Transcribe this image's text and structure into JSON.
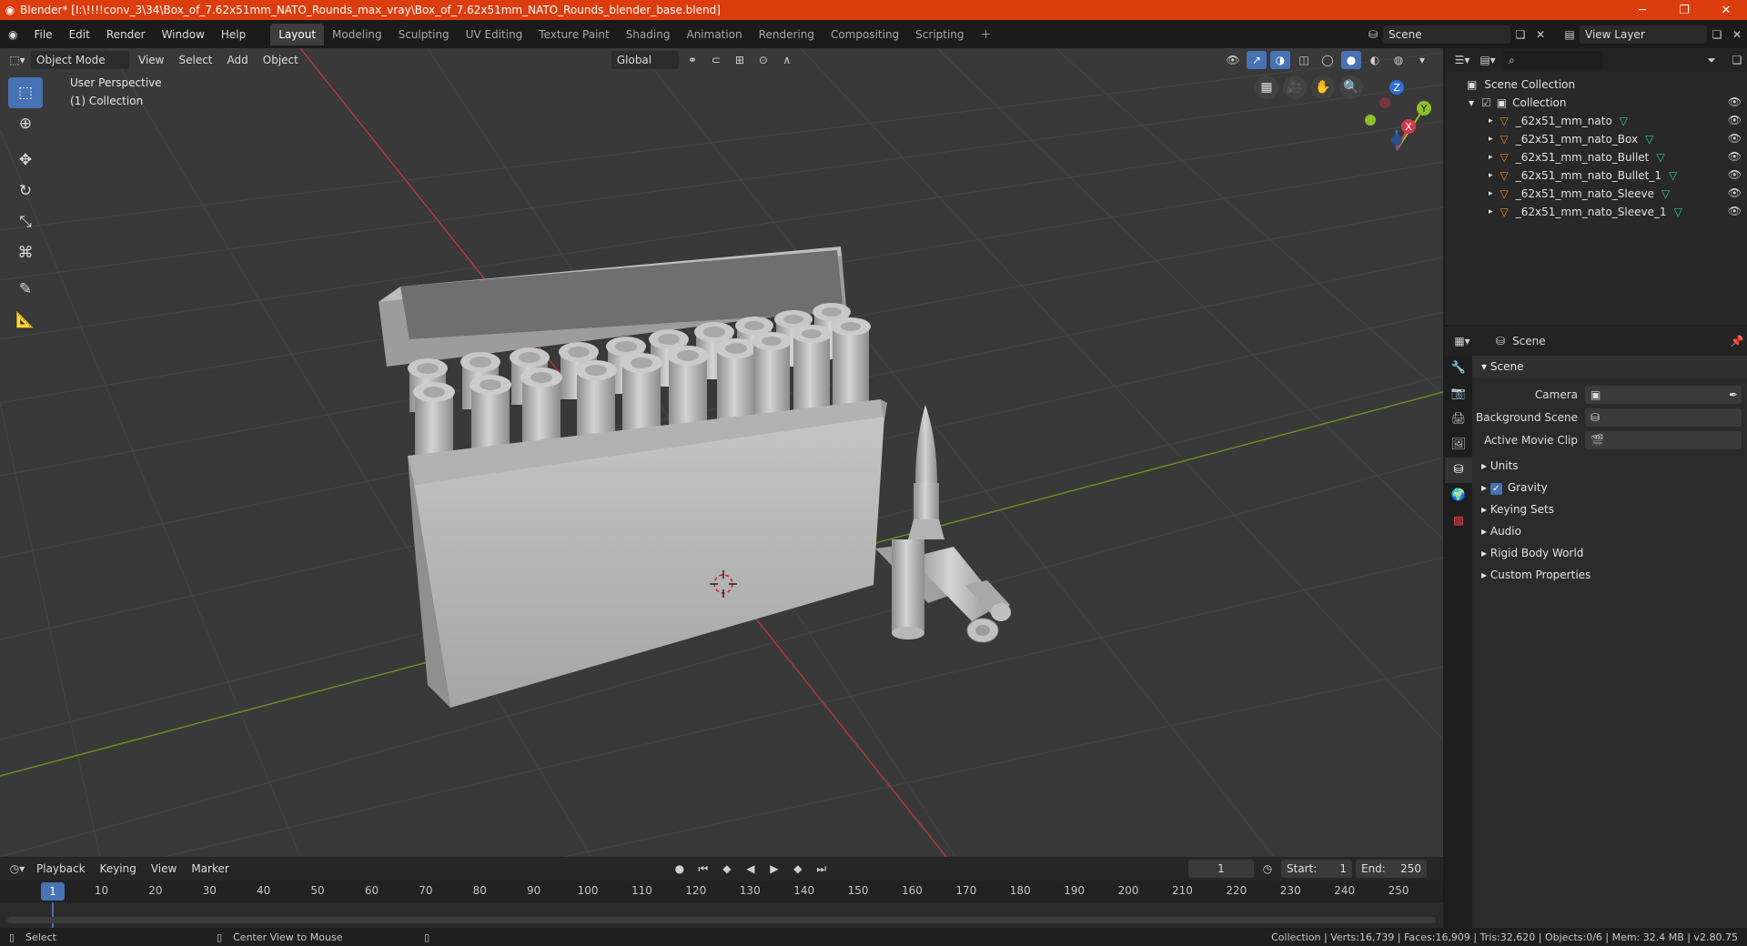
{
  "titlebar": {
    "text": "Blender* [I:\\!!!!conv_3\\34\\Box_of_7.62x51mm_NATO_Rounds_max_vray\\Box_of_7.62x51mm_NATO_Rounds_blender_base.blend]",
    "accent": "#dc3d0e"
  },
  "menu": [
    "File",
    "Edit",
    "Render",
    "Window",
    "Help"
  ],
  "workspaces": [
    "Layout",
    "Modeling",
    "Sculpting",
    "UV Editing",
    "Texture Paint",
    "Shading",
    "Animation",
    "Rendering",
    "Compositing",
    "Scripting"
  ],
  "active_workspace": "Layout",
  "scene_field": "Scene",
  "view_layer_field": "View Layer",
  "viewport": {
    "mode": "Object Mode",
    "menus": [
      "View",
      "Select",
      "Add",
      "Object"
    ],
    "transform": "Global",
    "info_line1": "User Perspective",
    "info_line2": "(1) Collection",
    "gizmo": {
      "x": "X",
      "y": "Y",
      "z": "Z"
    }
  },
  "outliner": {
    "root": "Scene Collection",
    "collection": "Collection",
    "objects": [
      "_62x51_mm_nato",
      "_62x51_mm_nato_Box",
      "_62x51_mm_nato_Bullet",
      "_62x51_mm_nato_Bullet_1",
      "_62x51_mm_nato_Sleeve",
      "_62x51_mm_nato_Sleeve_1"
    ]
  },
  "properties": {
    "header": "Scene",
    "section": "Scene",
    "camera_label": "Camera",
    "background_scene_label": "Background Scene",
    "movie_clip_label": "Active Movie Clip",
    "panels": [
      "Units",
      "Gravity",
      "Keying Sets",
      "Audio",
      "Rigid Body World",
      "Custom Properties"
    ]
  },
  "timeline": {
    "menus": [
      "Playback",
      "Keying",
      "View",
      "Marker"
    ],
    "current_frame": "1",
    "start_label": "Start:",
    "start": "1",
    "end_label": "End:",
    "end": "250",
    "ticks": [
      "1",
      "10",
      "20",
      "30",
      "40",
      "50",
      "60",
      "70",
      "80",
      "90",
      "100",
      "110",
      "120",
      "130",
      "140",
      "150",
      "160",
      "170",
      "180",
      "190",
      "200",
      "210",
      "220",
      "230",
      "240",
      "250"
    ]
  },
  "status": {
    "left": "Select",
    "middle": "Center View to Mouse",
    "right": "Collection | Verts:16,739 | Faces:16,909 | Tris:32,620 | Objects:0/6 | Mem: 32.4 MB | v2.80.75"
  }
}
